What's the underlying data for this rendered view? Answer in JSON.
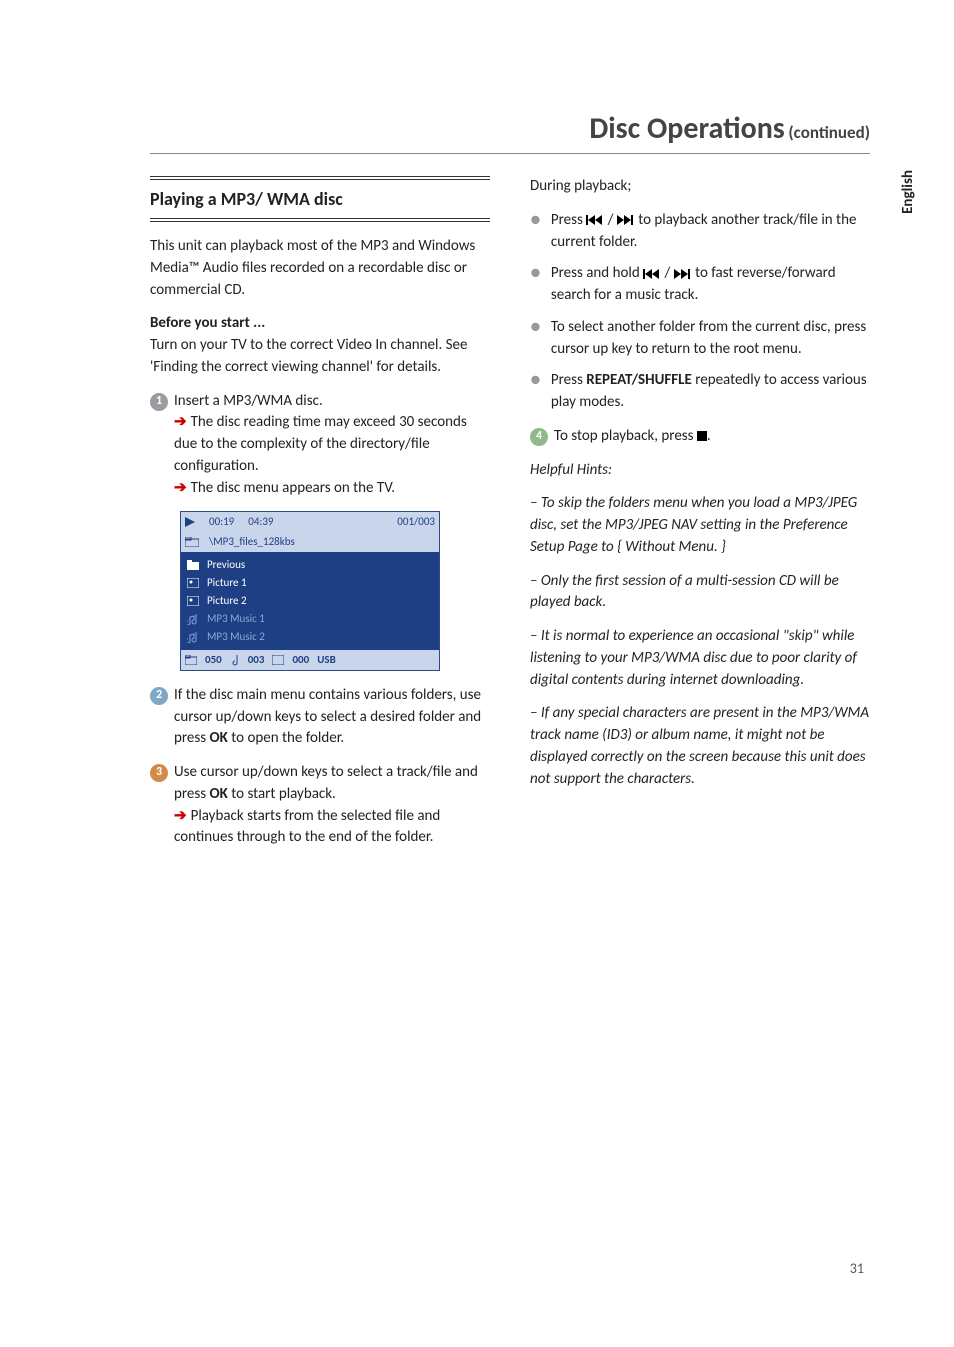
{
  "lang_tab": "English",
  "page_number": "31",
  "title": "Disc Operations",
  "title_continued": "(continued)",
  "left": {
    "heading": "Playing a MP3/ WMA disc",
    "intro": "This unit can playback most of the MP3 and Windows Media™ Audio files recorded on a recordable disc or commercial CD.",
    "before_label": "Before you start ...",
    "before_text": "Turn on your TV to the correct Video In channel.  See 'Finding the correct viewing channel' for details.",
    "step1_lead": "Insert a MP3/WMA disc.",
    "step1_bullet1": "The disc reading time may exceed 30 seconds due to the complexity of the directory/file configuration.",
    "step1_bullet2": "The disc menu appears on the TV.",
    "step2": "If the disc main menu contains various folders, use cursor up/down keys to select a desired folder and press ",
    "step2_ok": "OK",
    "step2_tail": " to open the folder.",
    "step3_lead": "Use cursor up/down keys to select a track/file and press ",
    "step3_ok": "OK",
    "step3_tail": " to start playback.",
    "step3_bullet": "Playback starts from the selected file and continues through to the end of the folder."
  },
  "disc_menu": {
    "time1": "00:19",
    "time2": "04:39",
    "counter": "001/003",
    "path": "\\MP3_files_128kbs",
    "previous": "Previous",
    "rows": [
      "Picture 1",
      "Picture 2",
      "MP3 Music 1",
      "MP3 Music 2"
    ],
    "bottom_a": "050",
    "bottom_b": "003",
    "bottom_c": "000",
    "bottom_usb": "USB"
  },
  "right": {
    "during": "During playback;",
    "b1a": "Press ",
    "b1b": " to playback another track/file in the current folder.",
    "b2a": "Press and hold ",
    "b2b": " to fast reverse/forward search for a music track.",
    "b3": "To select another folder from the current disc, press cursor up key to return to the root menu.",
    "b4a": "Press ",
    "b4_key": "REPEAT/SHUFFLE",
    "b4b": " repeatedly to access various play modes.",
    "step4a": "To stop playback, press ",
    "step4b": ".",
    "hints_title": "Helpful Hints:",
    "hint1": "– To skip the folders menu when you load a MP3/JPEG disc, set the MP3/JPEG NAV setting in the Preference Setup Page to { Without Menu. }",
    "hint2": "– Only the first session of a multi-session CD will be played back.",
    "hint3": "– It is normal to experience an occasional \"skip\" while listening to your MP3/WMA disc due to poor clarity of digital contents during internet downloading.",
    "hint4": "– If any special characters are present in the MP3/WMA track name (ID3) or album name, it might not be displayed correctly on the screen because this unit does not support the characters."
  }
}
